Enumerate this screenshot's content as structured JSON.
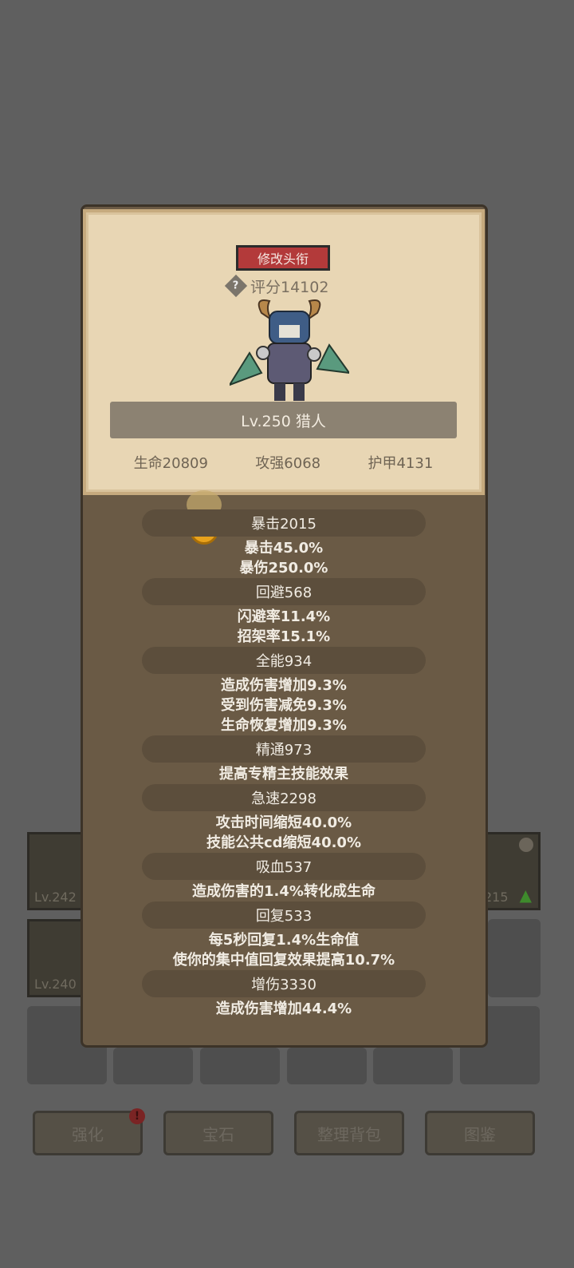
{
  "modal": {
    "change_title_label": "修改头衔",
    "score_label": "评分14102",
    "help_icon": "?",
    "hero_name": "Lv.250 猎人",
    "base_stats": [
      "生命20809",
      "攻强6068",
      "护甲4131"
    ]
  },
  "stats": [
    {
      "header": "暴击2015",
      "lines": [
        "暴击45.0%",
        "暴伤250.0%"
      ]
    },
    {
      "header": "回避568",
      "lines": [
        "闪避率11.4%",
        "招架率15.1%"
      ]
    },
    {
      "header": "全能934",
      "lines": [
        "造成伤害增加9.3%",
        "受到伤害减免9.3%",
        "生命恢复增加9.3%"
      ]
    },
    {
      "header": "精通973",
      "lines": [
        "提高专精主技能效果"
      ]
    },
    {
      "header": "急速2298",
      "lines": [
        "攻击时间缩短40.0%",
        "技能公共cd缩短40.0%"
      ]
    },
    {
      "header": "吸血537",
      "lines": [
        "造成伤害的1.4%转化成生命"
      ]
    },
    {
      "header": "回复533",
      "lines": [
        "每5秒回复1.4%生命值",
        "使你的集中值回复效果提高10.7%"
      ]
    },
    {
      "header": "增伤3330",
      "lines": [
        "造成伤害增加44.4%"
      ]
    }
  ],
  "background": {
    "equip_levels": [
      "Lv.242",
      "Lv.240",
      "215"
    ],
    "bottom_buttons": [
      "强化",
      "宝石",
      "整理背包",
      "图鉴"
    ],
    "badge": "!"
  },
  "colors": {
    "title_button": "#b33a3a",
    "card": "#e8d6b4",
    "panel": "#6a5a45"
  }
}
